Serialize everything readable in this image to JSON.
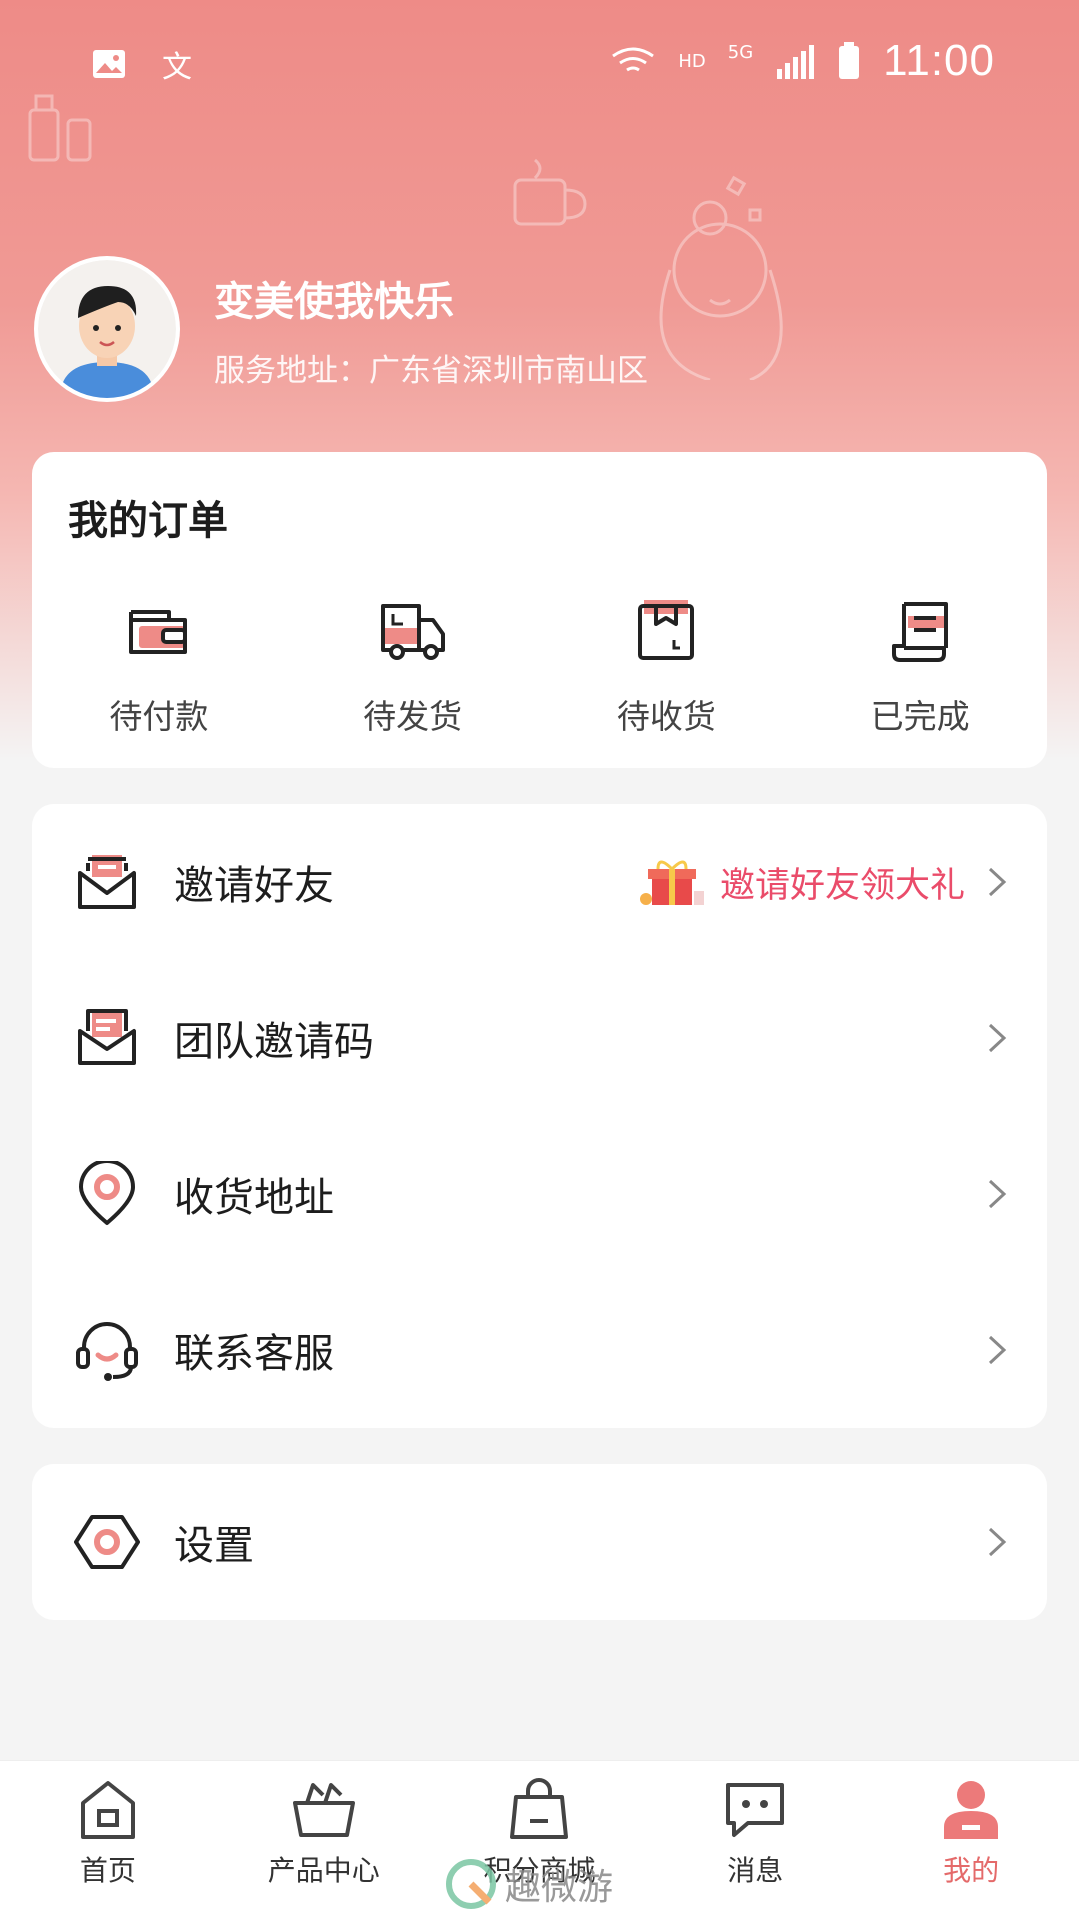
{
  "status_bar": {
    "network_hd": "HD",
    "network_5g": "5G",
    "time": "11:00"
  },
  "profile": {
    "username": "变美使我快乐",
    "address": "服务地址：广东省深圳市南山区"
  },
  "orders": {
    "title": "我的订单",
    "items": [
      {
        "label": "待付款",
        "icon": "wallet-icon"
      },
      {
        "label": "待发货",
        "icon": "truck-icon"
      },
      {
        "label": "待收货",
        "icon": "package-icon"
      },
      {
        "label": "已完成",
        "icon": "receipt-icon"
      }
    ]
  },
  "menu": {
    "items": [
      {
        "label": "邀请好友",
        "icon": "envelope-icon",
        "promo": "邀请好友领大礼"
      },
      {
        "label": "团队邀请码",
        "icon": "mail-open-icon"
      },
      {
        "label": "收货地址",
        "icon": "location-pin-icon"
      },
      {
        "label": "联系客服",
        "icon": "headset-icon"
      }
    ]
  },
  "settings": {
    "label": "设置",
    "icon": "hexagon-gear-icon"
  },
  "tabbar": {
    "items": [
      {
        "label": "首页",
        "icon": "home-icon"
      },
      {
        "label": "产品中心",
        "icon": "basket-icon"
      },
      {
        "label": "积分商城",
        "icon": "shopping-bag-icon"
      },
      {
        "label": "消息",
        "icon": "message-icon"
      },
      {
        "label": "我的",
        "icon": "user-icon",
        "active": true
      }
    ]
  },
  "watermark": {
    "text": "趣微游"
  },
  "colors": {
    "accent": "#ee8b87",
    "active_tab": "#e46a6a",
    "promo": "#ea4c6a"
  }
}
